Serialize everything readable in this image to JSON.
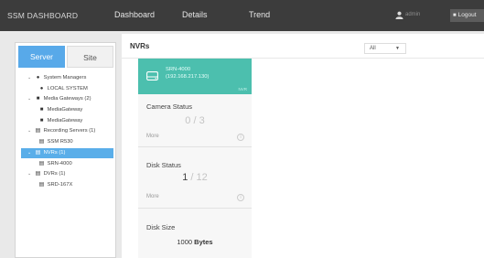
{
  "header": {
    "brand": "SSM DASHBOARD",
    "nav": [
      "Dashboard",
      "Details",
      "Trend"
    ],
    "user": "admin",
    "logout_label": "Logout"
  },
  "sidebar": {
    "tabs": [
      "Server",
      "Site"
    ],
    "active_tab": "Server",
    "tree": [
      {
        "label": "System Managers",
        "icon": "shield-icon"
      },
      {
        "label": "LOCAL SYSTEM",
        "icon": "shield-icon"
      },
      {
        "label": "Media Gateways (2)",
        "icon": "gateway-icon"
      },
      {
        "label": "MediaGateway",
        "icon": "gateway-icon"
      },
      {
        "label": "MediaGateway",
        "icon": "gateway-icon"
      },
      {
        "label": "Recording Servers (1)",
        "icon": "server-icon"
      },
      {
        "label": "SSM R530",
        "icon": "server-icon"
      },
      {
        "label": "NVRs (1)",
        "icon": "server-icon",
        "selected": true
      },
      {
        "label": "SRN-4000",
        "icon": "server-icon"
      },
      {
        "label": "DVRs (1)",
        "icon": "server-icon"
      },
      {
        "label": "SRD-167X",
        "icon": "server-icon"
      }
    ]
  },
  "main": {
    "title": "NVRs",
    "filter_value": "All",
    "device": {
      "name": "SRN-4000",
      "ip": "(192.168.217.130)",
      "tag": "NVR",
      "accent": "#4cbfae"
    },
    "camera_status": {
      "title": "Camera Status",
      "value": "0",
      "total": "/ 3",
      "more": "More"
    },
    "disk_status": {
      "title": "Disk Status",
      "value": "1",
      "total": "/ 12",
      "more": "More"
    },
    "disk_size": {
      "title": "Disk Size",
      "value": "1000",
      "unit": "Bytes"
    }
  },
  "colors": {
    "topbar": "#3c3c3c",
    "selected": "#5aaee9",
    "card_header": "#4cbfae"
  }
}
